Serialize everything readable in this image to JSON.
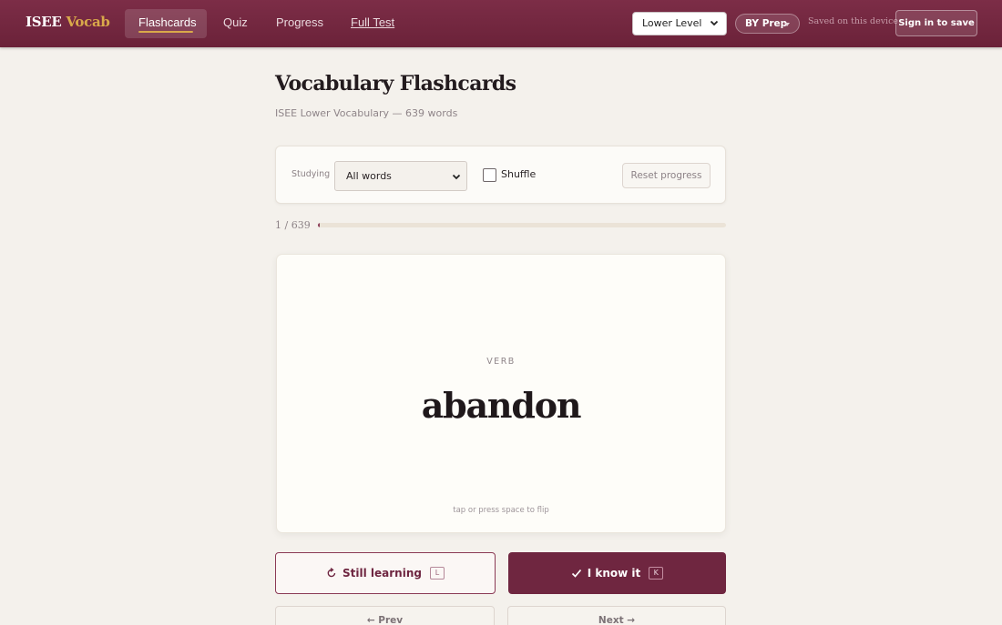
{
  "nav": {
    "brand_part1": "ISEE",
    "brand_part2": "Vocab",
    "tabs": [
      {
        "label": "Flashcards"
      },
      {
        "label": "Quiz"
      },
      {
        "label": "Progress"
      },
      {
        "label": "Full Test"
      }
    ],
    "level_select_value": "Lower Level",
    "prep_label": "BY Prep",
    "saved_note": "Saved on this device",
    "signin_label": "Sign in to save"
  },
  "header": {
    "title": "Vocabulary Flashcards",
    "subtitle": "ISEE Lower Vocabulary — 639 words"
  },
  "controls": {
    "studying_label": "Studying",
    "studying_value": "All words",
    "shuffle_label": "Shuffle",
    "shuffle_checked": false,
    "reset_label": "Reset progress"
  },
  "progress": {
    "counter": "1 / 639",
    "fraction": 0.0016
  },
  "card": {
    "part_of_speech": "VERB",
    "word": "abandon",
    "hint": "tap or press space to flip"
  },
  "actions": {
    "still_learning_label": "Still learning",
    "still_learning_key": "L",
    "know_it_label": "I know it",
    "know_it_key": "K",
    "prev_label": "← Prev",
    "next_label": "Next →"
  },
  "colors": {
    "navbar": "#7c2d47",
    "accent_gold": "#d9a94a",
    "primary_button": "#6f2640",
    "background": "#f4f1ec"
  },
  "icons": {
    "select_chevron": "chevron-down-icon",
    "prep_caret": "caret-down-icon",
    "still_learning": "refresh-icon",
    "know_it": "check-icon"
  }
}
